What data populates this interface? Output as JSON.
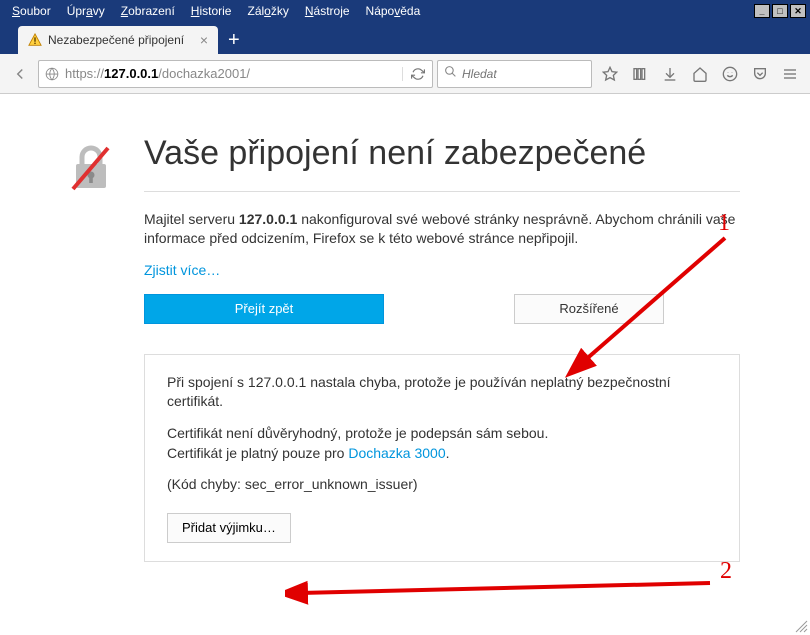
{
  "menu": {
    "items": [
      {
        "pre": "",
        "ul": "S",
        "post": "oubor"
      },
      {
        "pre": "Úpr",
        "ul": "a",
        "post": "vy"
      },
      {
        "pre": "",
        "ul": "Z",
        "post": "obrazení"
      },
      {
        "pre": "",
        "ul": "H",
        "post": "istorie"
      },
      {
        "pre": "Zál",
        "ul": "o",
        "post": "žky"
      },
      {
        "pre": "",
        "ul": "N",
        "post": "ástroje"
      },
      {
        "pre": "Nápo",
        "ul": "v",
        "post": "ěda"
      }
    ]
  },
  "tab": {
    "title": "Nezabezpečené připojení"
  },
  "url": {
    "proto": "https://",
    "host": "127.0.0.1",
    "path": "/dochazka2001/"
  },
  "search": {
    "placeholder": "Hledat"
  },
  "page": {
    "heading": "Vaše připojení není zabezpečené",
    "desc_pre": "Majitel serveru ",
    "desc_host": "127.0.0.1",
    "desc_post": " nakonfiguroval své webové stránky nesprávně. Abychom chránili vaše informace před odcizením, Firefox se k této webové stránce nepřipojil.",
    "learn_more": "Zjistit více…",
    "btn_back": "Přejít zpět",
    "btn_advanced": "Rozšířené",
    "panel_line1": "Při spojení s 127.0.0.1 nastala chyba, protože je používán neplatný bezpečnostní certifikát.",
    "panel_line2a": "Certifikát není důvěryhodný, protože je podepsán sám sebou.",
    "panel_line2b_pre": "Certifikát je platný pouze pro ",
    "panel_line2b_link": "Dochazka 3000",
    "panel_line2b_post": ".",
    "panel_err": "(Kód chyby: sec_error_unknown_issuer)",
    "btn_exception": "Přidat výjimku…"
  },
  "annotations": {
    "n1": "1",
    "n2": "2"
  }
}
